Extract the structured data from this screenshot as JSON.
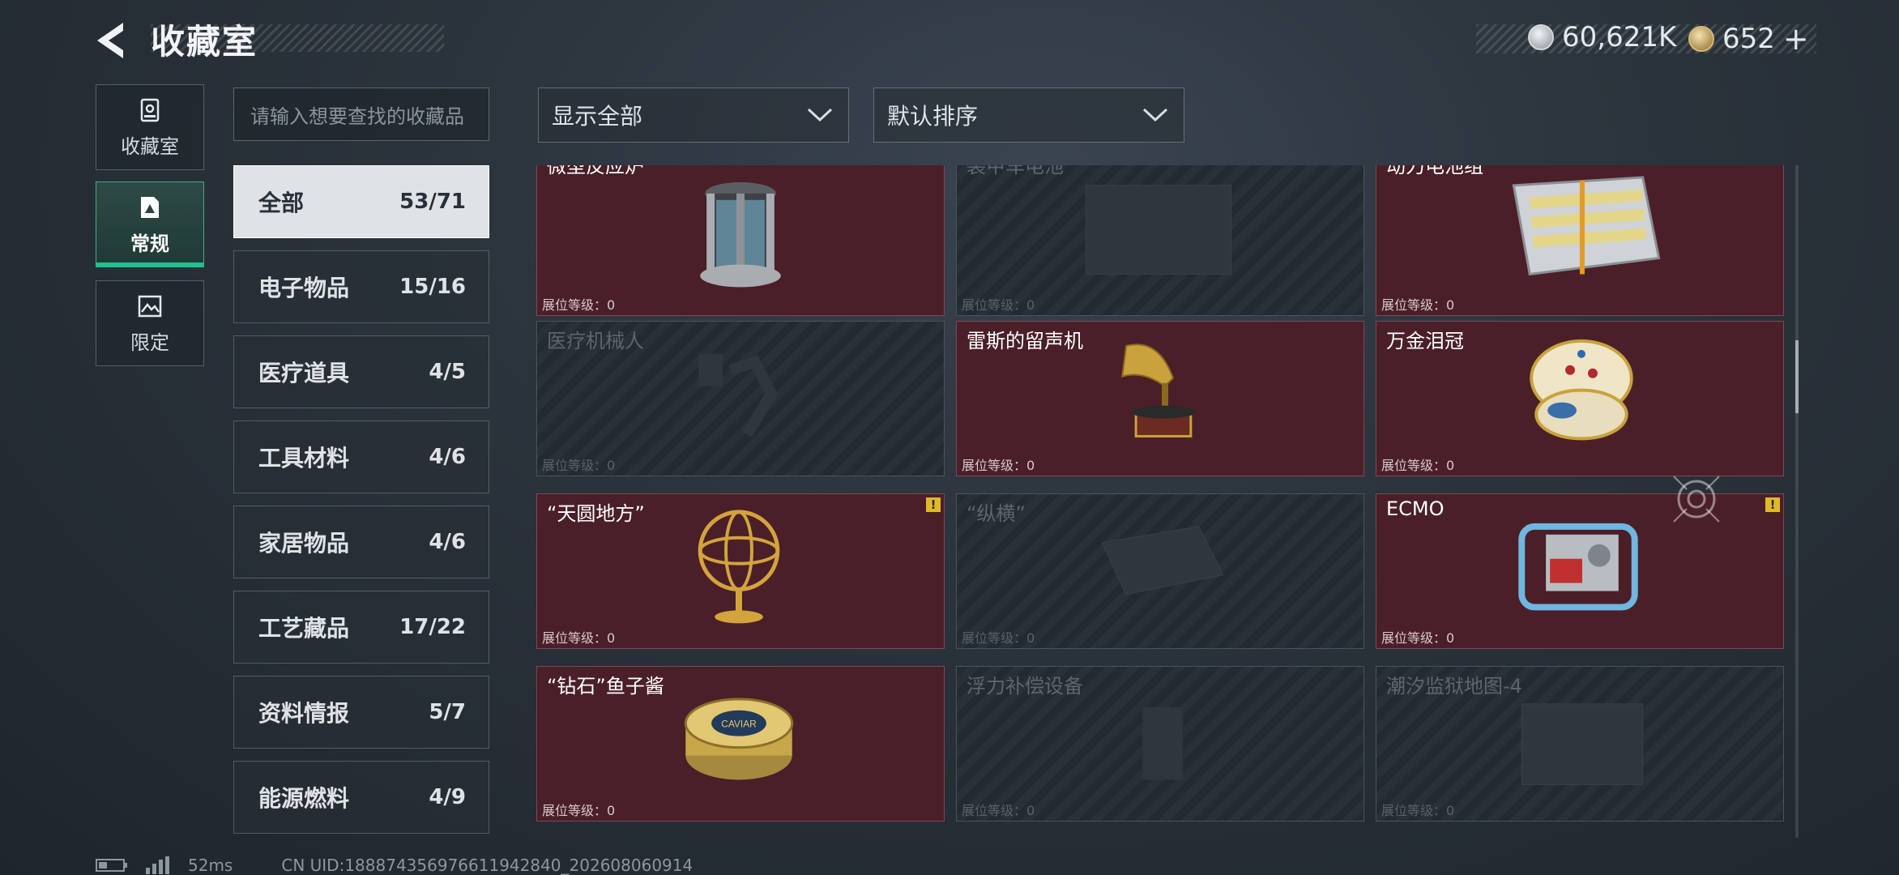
{
  "header": {
    "title": "收藏室",
    "currency": [
      {
        "name": "silver-coin",
        "value": "60,621K",
        "color": "#c9ced3"
      },
      {
        "name": "gold-coin",
        "value": "652",
        "plus": "+",
        "color": "#c9a45a"
      }
    ]
  },
  "side_tabs": [
    {
      "label": "收藏室",
      "icon": "vault-icon"
    },
    {
      "label": "常规",
      "icon": "collection-card-icon",
      "active": true
    },
    {
      "label": "限定",
      "icon": "limited-image-icon"
    }
  ],
  "search": {
    "placeholder": "请输入想要查找的收藏品"
  },
  "categories": [
    {
      "name": "全部",
      "count": "53/71"
    },
    {
      "name": "电子物品",
      "count": "15/16"
    },
    {
      "name": "医疗道具",
      "count": "4/5"
    },
    {
      "name": "工具材料",
      "count": "4/6"
    },
    {
      "name": "家居物品",
      "count": "4/6"
    },
    {
      "name": "工艺藏品",
      "count": "17/22"
    },
    {
      "name": "资料情报",
      "count": "5/7"
    },
    {
      "name": "能源燃料",
      "count": "4/9"
    }
  ],
  "filters": {
    "display": "显示全部",
    "sort": "默认排序"
  },
  "items": [
    {
      "name": "微型反应炉",
      "level": "展位等级：0",
      "owned": true
    },
    {
      "name": "装甲车电池",
      "level": "展位等级：0",
      "owned": false
    },
    {
      "name": "动力电池组",
      "level": "展位等级：0",
      "owned": true
    },
    {
      "name": "医疗机械人",
      "level": "展位等级：0",
      "owned": false
    },
    {
      "name": "雷斯的留声机",
      "level": "展位等级：0",
      "owned": true
    },
    {
      "name": "万金泪冠",
      "level": "展位等级：0",
      "owned": true
    },
    {
      "name": "“天圆地方”",
      "level": "展位等级：0",
      "owned": true,
      "warning": "!"
    },
    {
      "name": "“纵横”",
      "level": "展位等级：0",
      "owned": false
    },
    {
      "name": "ECMO",
      "level": "展位等级：0",
      "owned": true,
      "warning": "!"
    },
    {
      "name": "“钻石”鱼子酱",
      "level": "展位等级：0",
      "owned": true
    },
    {
      "name": "浮力补偿设备",
      "level": "展位等级：0",
      "owned": false
    },
    {
      "name": "潮汐监狱地图-4",
      "level": "展位等级：0",
      "owned": false
    }
  ],
  "caviar_label": "CAVIAR",
  "footer": {
    "ping": "52ms",
    "uid": "CN UID:1888743569766119428​40_202608060914"
  }
}
